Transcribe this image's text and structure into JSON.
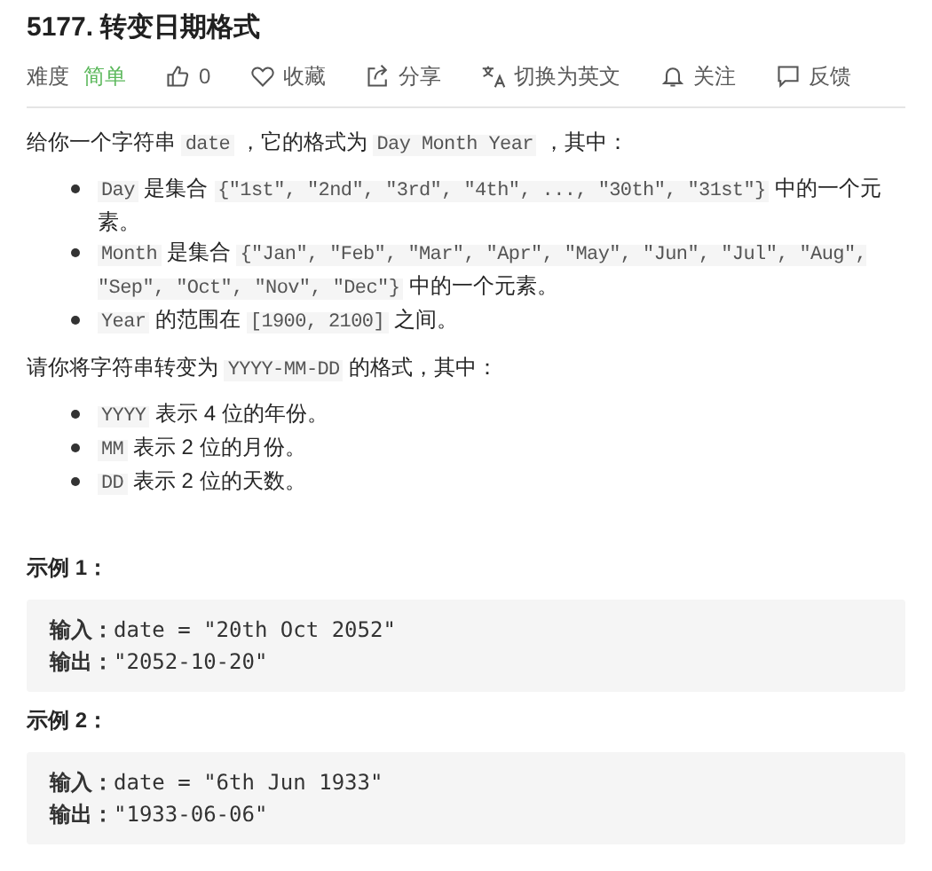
{
  "title": "5177. 转变日期格式",
  "meta": {
    "difficulty_label": "难度",
    "difficulty": {
      "text": "简单",
      "kind": "easy"
    },
    "actions": [
      {
        "kind": "like",
        "label": "0"
      },
      {
        "kind": "favorite",
        "label": "收藏"
      },
      {
        "kind": "share",
        "label": "分享"
      },
      {
        "kind": "translate",
        "label": "切换为英文"
      },
      {
        "kind": "follow",
        "label": "关注"
      },
      {
        "kind": "feedback",
        "label": "反馈"
      }
    ]
  },
  "description": [
    {
      "kind": "paragraph",
      "segments": [
        {
          "kind": "text",
          "text": "给你一个字符串 "
        },
        {
          "kind": "code",
          "text": "date"
        },
        {
          "kind": "text",
          "text": " ，它的格式为 "
        },
        {
          "kind": "code",
          "text": "Day Month Year"
        },
        {
          "kind": "text",
          "text": " ，其中："
        }
      ]
    },
    {
      "kind": "list",
      "items": [
        [
          {
            "kind": "code",
            "text": "Day"
          },
          {
            "kind": "text",
            "text": " 是集合 "
          },
          {
            "kind": "code",
            "text": "{\"1st\", \"2nd\", \"3rd\", \"4th\", ..., \"30th\", \"31st\"}"
          },
          {
            "kind": "text",
            "text": " 中的一个元素。"
          }
        ],
        [
          {
            "kind": "code",
            "text": "Month"
          },
          {
            "kind": "text",
            "text": " 是集合 "
          },
          {
            "kind": "code",
            "text": "{\"Jan\", \"Feb\", \"Mar\", \"Apr\", \"May\", \"Jun\", \"Jul\", \"Aug\", \"Sep\", \"Oct\", \"Nov\", \"Dec\"}"
          },
          {
            "kind": "text",
            "text": " 中的一个元素。"
          }
        ],
        [
          {
            "kind": "code",
            "text": "Year"
          },
          {
            "kind": "text",
            "text": " 的范围在 "
          },
          {
            "kind": "code",
            "text": "[1900, 2100]"
          },
          {
            "kind": "text",
            "text": " 之间。"
          }
        ]
      ]
    },
    {
      "kind": "paragraph",
      "segments": [
        {
          "kind": "text",
          "text": "请你将字符串转变为 "
        },
        {
          "kind": "code",
          "text": "YYYY-MM-DD"
        },
        {
          "kind": "text",
          "text": " 的格式，其中："
        }
      ]
    },
    {
      "kind": "list",
      "items": [
        [
          {
            "kind": "code",
            "text": "YYYY"
          },
          {
            "kind": "text",
            "text": " 表示 4 位的年份。"
          }
        ],
        [
          {
            "kind": "code",
            "text": "MM"
          },
          {
            "kind": "text",
            "text": " 表示 2 位的月份。"
          }
        ],
        [
          {
            "kind": "code",
            "text": "DD"
          },
          {
            "kind": "text",
            "text": " 表示 2 位的天数。"
          }
        ]
      ]
    }
  ],
  "examples": [
    {
      "heading": "示例 1：",
      "lines": [
        {
          "label": "输入：",
          "value": "date = \"20th Oct 2052\""
        },
        {
          "label": "输出：",
          "value": "\"2052-10-20\""
        }
      ]
    },
    {
      "heading": "示例 2：",
      "lines": [
        {
          "label": "输入：",
          "value": "date = \"6th Jun 1933\""
        },
        {
          "label": "输出：",
          "value": "\"1933-06-06\""
        }
      ]
    }
  ]
}
